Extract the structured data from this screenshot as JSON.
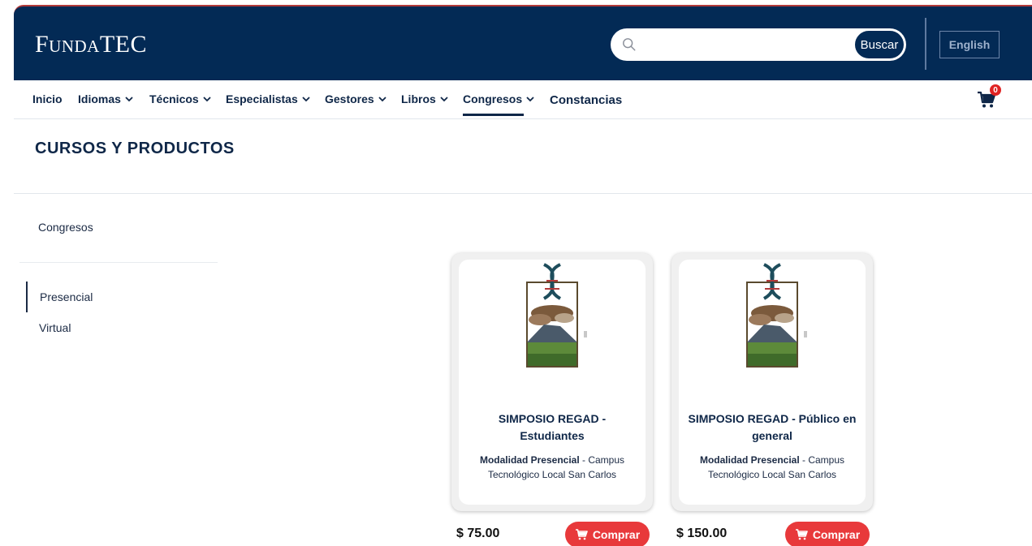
{
  "header": {
    "logo": "FundaTEC",
    "search_placeholder": "",
    "search_button": "Buscar",
    "language_button": "English"
  },
  "nav": {
    "items": [
      {
        "label": "Inicio",
        "dropdown": false
      },
      {
        "label": "Idiomas",
        "dropdown": true
      },
      {
        "label": "Técnicos",
        "dropdown": true
      },
      {
        "label": "Especialistas",
        "dropdown": true
      },
      {
        "label": "Gestores",
        "dropdown": true
      },
      {
        "label": "Libros",
        "dropdown": true
      },
      {
        "label": "Congresos",
        "dropdown": true,
        "active": true
      },
      {
        "label": "Constancias",
        "dropdown": false
      }
    ],
    "cart_count": "0"
  },
  "page": {
    "title": "CURSOS Y PRODUCTOS"
  },
  "sidebar": {
    "heading": "Congresos",
    "items": [
      {
        "label": "Presencial",
        "active": true
      },
      {
        "label": "Virtual",
        "active": false
      }
    ]
  },
  "products": [
    {
      "title": "SIMPOSIO REGAD - Estudiantes",
      "modality": "Modalidad Presencial",
      "location": " - Campus Tecnológico Local San Carlos",
      "price": "$ 75.00",
      "buy_label": "Comprar"
    },
    {
      "title": "SIMPOSIO REGAD - Público en general",
      "modality": "Modalidad Presencial",
      "location": " - Campus Tecnológico Local San Carlos",
      "price": "$ 150.00",
      "buy_label": "Comprar"
    }
  ],
  "colors": {
    "header_bg": "#032a55",
    "nav_text": "#0f2748",
    "buy_button": "#e8393b",
    "cart_badge": "#e02424"
  }
}
